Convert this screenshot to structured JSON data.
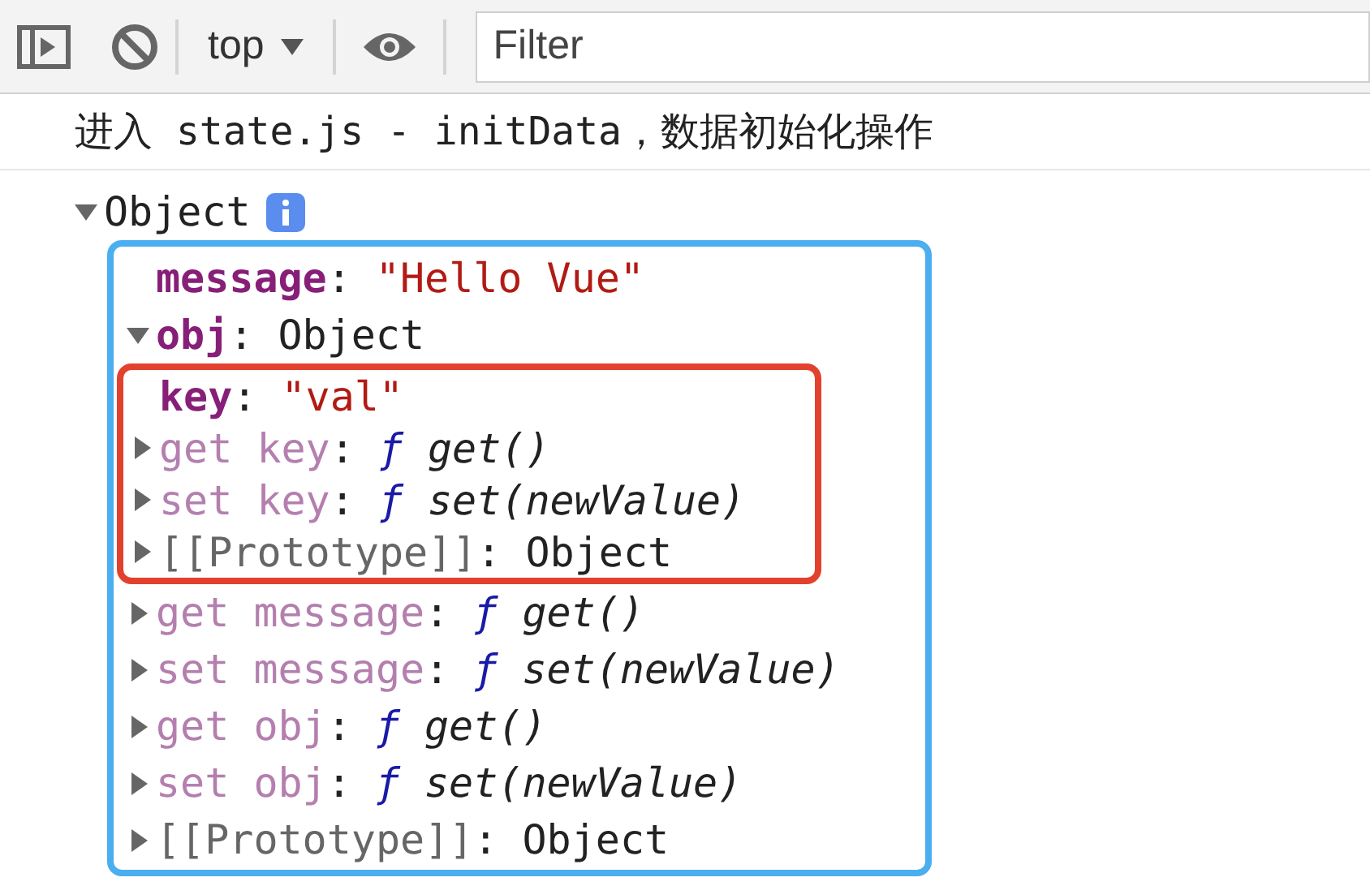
{
  "toolbar": {
    "context": "top",
    "filter": {
      "placeholder": "Filter"
    }
  },
  "console": {
    "message": "进入 state.js - initData，数据初始化操作",
    "object": {
      "label": "Object",
      "expanded": true,
      "color": "#4aaef0",
      "children": [
        {
          "kind": "data",
          "key": "message",
          "separator": ":",
          "value": {
            "kind": "string",
            "text": "\"Hello Vue\""
          }
        },
        {
          "kind": "data",
          "key": "obj",
          "separator": ":",
          "value": {
            "kind": "object",
            "text": "Object"
          },
          "expanded": true,
          "color": "#e2412e",
          "children": [
            {
              "kind": "data",
              "key": "key",
              "separator": ":",
              "value": {
                "kind": "string",
                "text": "\"val\""
              }
            },
            {
              "kind": "accessor",
              "key": "get key",
              "separator": ":",
              "marker": "ƒ",
              "value": {
                "kind": "function",
                "text": "get()"
              },
              "expanded": false
            },
            {
              "kind": "accessor",
              "key": "set key",
              "separator": ":",
              "marker": "ƒ",
              "value": {
                "kind": "function",
                "text": "set(newValue)"
              },
              "expanded": false
            },
            {
              "kind": "internal",
              "key": "[[Prototype]]",
              "separator": ":",
              "value": {
                "kind": "object",
                "text": "Object"
              },
              "expanded": false
            }
          ]
        },
        {
          "kind": "accessor",
          "key": "get message",
          "separator": ":",
          "marker": "ƒ",
          "value": {
            "kind": "function",
            "text": "get()"
          },
          "expanded": false
        },
        {
          "kind": "accessor",
          "key": "set message",
          "separator": ":",
          "marker": "ƒ",
          "value": {
            "kind": "function",
            "text": "set(newValue)"
          },
          "expanded": false
        },
        {
          "kind": "accessor",
          "key": "get obj",
          "separator": ":",
          "marker": "ƒ",
          "value": {
            "kind": "function",
            "text": "get()"
          },
          "expanded": false
        },
        {
          "kind": "accessor",
          "key": "set obj",
          "separator": ":",
          "marker": "ƒ",
          "value": {
            "kind": "function",
            "text": "set(newValue)"
          },
          "expanded": false
        },
        {
          "kind": "internal",
          "key": "[[Prototype]]",
          "separator": ":",
          "value": {
            "kind": "object",
            "text": "Object"
          },
          "expanded": false
        }
      ]
    }
  }
}
